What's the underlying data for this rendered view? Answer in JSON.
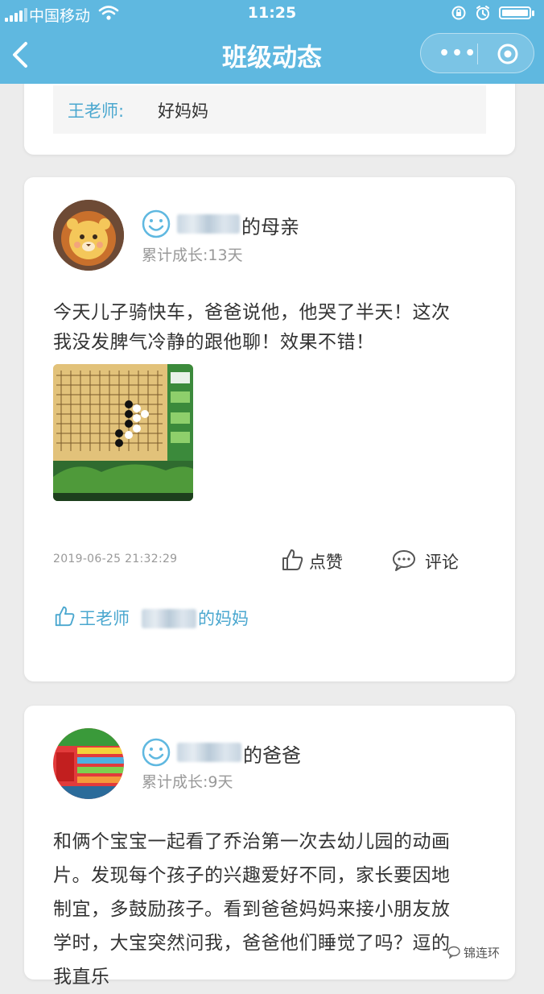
{
  "status_bar": {
    "carrier": "中国移动",
    "time": "11:25",
    "icons": [
      "signal-icon",
      "wifi-icon",
      "lock-rotation-icon",
      "alarm-icon",
      "battery-icon"
    ]
  },
  "nav": {
    "title": "班级动态",
    "more_label": "•••",
    "icons": [
      "back-icon",
      "more-icon",
      "close-target-icon"
    ]
  },
  "top_comment": {
    "author": "王老师:",
    "text": "好妈妈"
  },
  "posts": [
    {
      "author_suffix": "的母亲",
      "growth": "累计成长:13天",
      "content_lines": [
        "今天儿子骑快车，爸爸说他，他哭了半天！这次",
        "我没发脾气冷静的跟他聊！效果不错！"
      ],
      "timestamp": "2019-06-25 21:32:29",
      "like_label": "点赞",
      "comment_label": "评论",
      "liked_by_first": "王老师",
      "liked_by_second_suffix": "的妈妈"
    },
    {
      "author_suffix": "的爸爸",
      "growth": "累计成长:9天",
      "content_lines": [
        "和俩个宝宝一起看了乔治第一次去幼儿园的动画",
        "片。发现每个孩子的兴趣爱好不同，家长要因地",
        "制宜，多鼓励孩子。看到爸爸妈妈来接小朋友放",
        "学时，大宝突然问我，爸爸他们睡觉了吗？逗的",
        "我直乐"
      ]
    }
  ],
  "watermark": "锦连环",
  "colors": {
    "nav_bg": "#5fb8e0",
    "accent_blue": "#4aa7cf",
    "page_bg": "#ececec"
  }
}
